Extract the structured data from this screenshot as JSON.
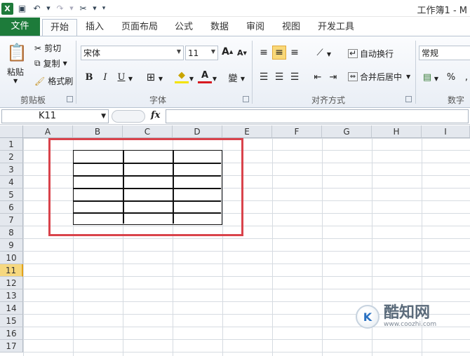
{
  "window": {
    "title": "工作簿1 - M"
  },
  "tabs": [
    {
      "label": "文件"
    },
    {
      "label": "开始"
    },
    {
      "label": "插入"
    },
    {
      "label": "页面布局"
    },
    {
      "label": "公式"
    },
    {
      "label": "数据"
    },
    {
      "label": "审阅"
    },
    {
      "label": "视图"
    },
    {
      "label": "开发工具"
    }
  ],
  "clipboard": {
    "paste": "粘贴",
    "cut": "剪切",
    "copy": "复制",
    "format_painter": "格式刷",
    "group_label": "剪贴板"
  },
  "font": {
    "name": "宋体",
    "size": "11",
    "grow": "A",
    "shrink": "A",
    "bold": "B",
    "italic": "I",
    "underline": "U",
    "wen": "變",
    "group_label": "字体"
  },
  "alignment": {
    "wrap_text": "自动换行",
    "merge_center": "合并后居中",
    "group_label": "对齐方式"
  },
  "number": {
    "format": "常规",
    "percent": "%",
    "comma": ",",
    "group_label": "数字"
  },
  "formula_bar": {
    "name_box": "K11",
    "fx": "fx",
    "value": ""
  },
  "columns": [
    "A",
    "B",
    "C",
    "D",
    "E",
    "F",
    "G",
    "H",
    "I"
  ],
  "rows": [
    "1",
    "2",
    "3",
    "4",
    "5",
    "6",
    "7",
    "8",
    "9",
    "10",
    "11",
    "12",
    "13",
    "14",
    "15",
    "16",
    "17"
  ],
  "selected_row": "11",
  "colors": {
    "file_tab": "#1d7b3a",
    "highlight_border": "#d9434b",
    "selected_header": "#f6d87f"
  },
  "watermark": {
    "name": "酷知网",
    "url": "www.coozhi.com"
  }
}
